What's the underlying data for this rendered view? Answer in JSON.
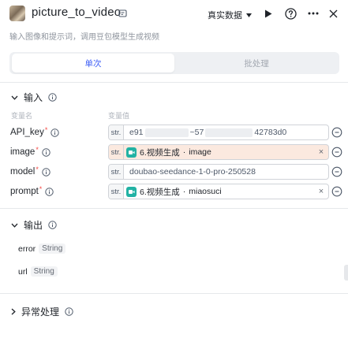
{
  "header": {
    "title": "picture_to_video",
    "subtitle": "输入图像和提示词，调用豆包模型生成视频",
    "dataset_label": "真实数据",
    "icons": [
      "edit-icon",
      "chevron-down-icon",
      "play-icon",
      "help-icon",
      "more-icon"
    ]
  },
  "tabs": [
    {
      "label": "单次",
      "active": true
    },
    {
      "label": "批处理",
      "active": false
    }
  ],
  "input_section": {
    "title": "输入",
    "col_var_name": "变量名",
    "col_var_value": "变量值",
    "rows": [
      {
        "name": "API_key",
        "type": "str.",
        "value_start": "e91",
        "value_mid": "~57",
        "value_end": "42783d0"
      },
      {
        "name": "image",
        "type": "str.",
        "ref_node": "6.视频生成",
        "ref_sep": "·",
        "ref_var": "image"
      },
      {
        "name": "model",
        "type": "str.",
        "value": "doubao-seedance-1-0-pro-250528"
      },
      {
        "name": "prompt",
        "type": "str.",
        "ref_node": "6.视频生成",
        "ref_sep": "·",
        "ref_var": "miaosuci"
      }
    ],
    "required_mark": "*",
    "clear_glyph": "×"
  },
  "output_section": {
    "title": "输出",
    "rows": [
      {
        "name": "error",
        "type": "String"
      },
      {
        "name": "url",
        "type": "String"
      }
    ]
  },
  "exception_section": {
    "title": "异常处理"
  },
  "colors": {
    "accent": "#3b5cf6",
    "required": "#f54a45",
    "ref_icon": "#22b2a4",
    "ref_highlight": "#fbe9df"
  }
}
